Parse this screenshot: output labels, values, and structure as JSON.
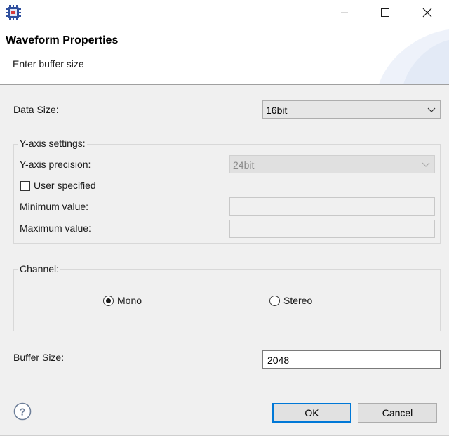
{
  "window": {
    "icon": "chip-app-icon",
    "controls": [
      "minimize-icon",
      "maximize-icon",
      "close-icon"
    ]
  },
  "header": {
    "title": "Waveform Properties",
    "subtitle": "Enter buffer size"
  },
  "data_size": {
    "label": "Data Size:",
    "value": "16bit"
  },
  "y_axis": {
    "group_title": "Y-axis settings:",
    "precision_label": "Y-axis precision:",
    "precision_value": "24bit",
    "precision_enabled": false,
    "user_specified_label": "User specified",
    "user_specified_checked": false,
    "min_label": "Minimum value:",
    "min_value": "",
    "max_label": "Maximum value:",
    "max_value": ""
  },
  "channel": {
    "group_title": "Channel:",
    "options": [
      {
        "label": "Mono",
        "selected": true
      },
      {
        "label": "Stereo",
        "selected": false
      }
    ]
  },
  "buffer_size": {
    "label": "Buffer Size:",
    "value": "2048"
  },
  "buttons": {
    "help_icon": "help-icon",
    "ok_label": "OK",
    "cancel_label": "Cancel"
  },
  "colors": {
    "accent": "#0078d7",
    "dialog_bg": "#f0f0f0",
    "header_bg": "#ffffff"
  }
}
